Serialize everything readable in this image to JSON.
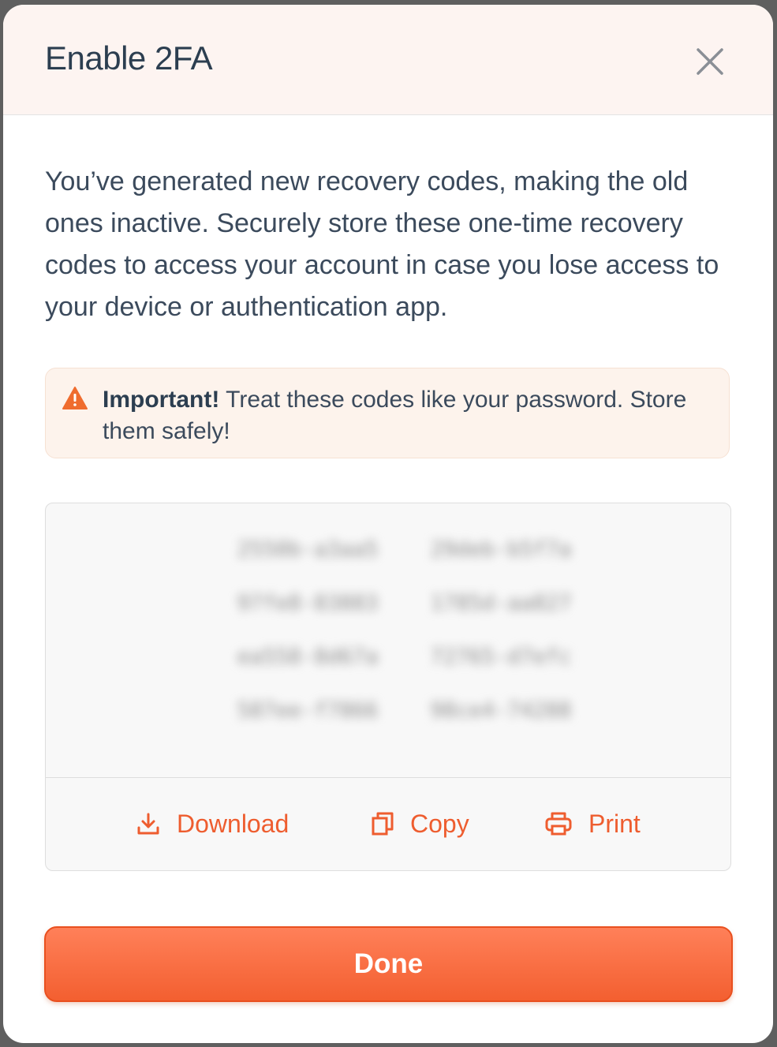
{
  "modal": {
    "title": "Enable 2FA",
    "description": "You’ve generated new recovery codes, making the old ones inactive. Securely store these one-time recovery codes to access your account in case you lose access to your device or authentication app."
  },
  "alert": {
    "icon": "warning-icon",
    "strong": "Important!",
    "text": " Treat these codes like your password. Store them safely!"
  },
  "codes": {
    "obscured": true,
    "items": [
      "2550b-a3aa5",
      "29deb-b5f7a",
      "97fe8-83883",
      "1785d-aa827",
      "ea558-8d67a",
      "72765-d7efc",
      "587ee-f7866",
      "98ce4-74288"
    ]
  },
  "actions": {
    "download_label": "Download",
    "copy_label": "Copy",
    "print_label": "Print"
  },
  "done_label": "Done",
  "colors": {
    "accent": "#ee5d2f",
    "header_bg": "#fdf4f1",
    "alert_bg": "#fdf3ec",
    "warning": "#ef6c2e"
  }
}
